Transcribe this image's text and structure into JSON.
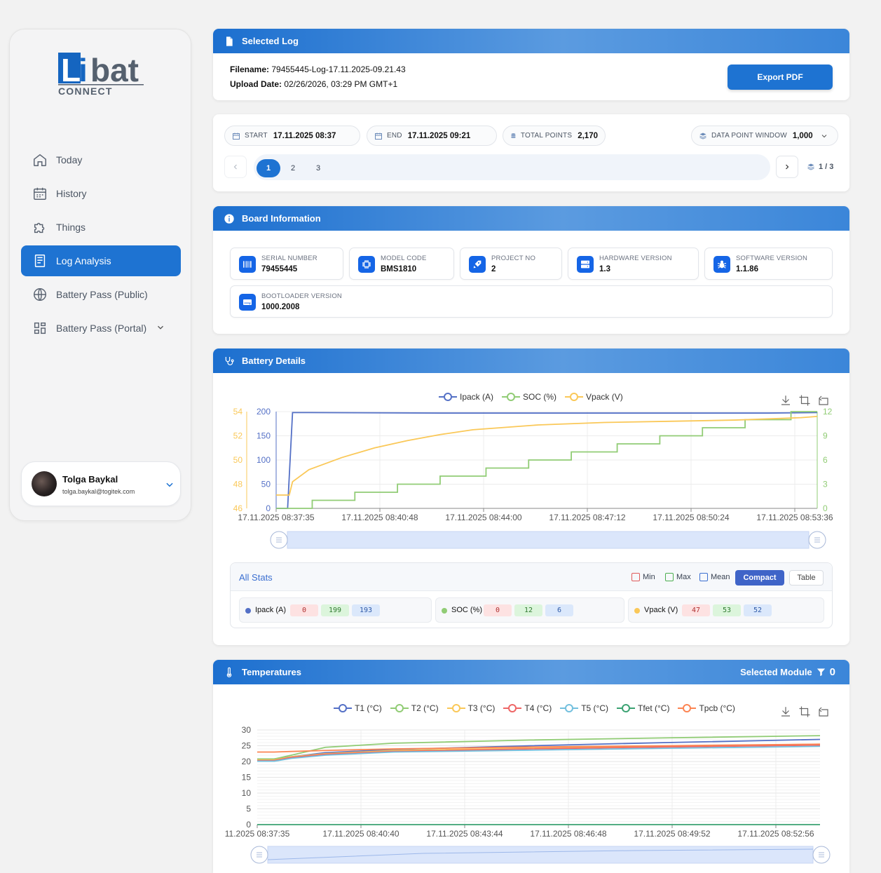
{
  "brand": {
    "logo_main": "Libat",
    "logo_sub": "CONNECT"
  },
  "nav": {
    "items": [
      {
        "label": "Today",
        "icon": "home-icon"
      },
      {
        "label": "History",
        "icon": "calendar-icon"
      },
      {
        "label": "Things",
        "icon": "puzzle-icon"
      },
      {
        "label": "Log Analysis",
        "icon": "document-icon",
        "active": true
      },
      {
        "label": "Battery Pass (Public)",
        "icon": "globe-icon"
      },
      {
        "label": "Battery Pass (Portal)",
        "icon": "grid-icon",
        "has_submenu": true
      }
    ]
  },
  "user": {
    "name": "Tolga Baykal",
    "email": "tolga.baykal@togitek.com"
  },
  "selected_log": {
    "title": "Selected Log",
    "filename_label": "Filename:",
    "filename": "79455445-Log-17.11.2025-09.21.43",
    "upload_label": "Upload Date:",
    "upload_date": "02/26/2026, 03:29 PM GMT+1",
    "export_label": "Export PDF"
  },
  "range": {
    "start_label": "START",
    "start": "17.11.2025 08:37",
    "end_label": "END",
    "end": "17.11.2025 09:21",
    "total_label": "TOTAL POINTS",
    "total": "2,170",
    "window_label": "DATA POINT WINDOW",
    "window": "1,000",
    "pages": [
      "1",
      "2",
      "3"
    ],
    "current_page": 1,
    "page_indicator": "1 / 3"
  },
  "board": {
    "title": "Board Information",
    "fields": [
      {
        "label": "SERIAL NUMBER",
        "value": "79455445",
        "icon": "barcode-icon"
      },
      {
        "label": "MODEL CODE",
        "value": "BMS1810",
        "icon": "chip-icon"
      },
      {
        "label": "PROJECT NO",
        "value": "2",
        "icon": "rocket-icon"
      },
      {
        "label": "HARDWARE VERSION",
        "value": "1.3",
        "icon": "server-icon"
      },
      {
        "label": "SOFTWARE VERSION",
        "value": "1.1.86",
        "icon": "bug-icon"
      },
      {
        "label": "BOOTLOADER VERSION",
        "value": "1000.2008",
        "icon": "drive-icon"
      }
    ]
  },
  "battery": {
    "title": "Battery Details",
    "stats_title": "All Stats",
    "toggles": {
      "min": "Min",
      "max": "Max",
      "mean": "Mean",
      "compact": "Compact",
      "table": "Table"
    },
    "stats": [
      {
        "name": "Ipack (A)",
        "color": "#5470c6",
        "min": "0",
        "max": "199",
        "mean": "193"
      },
      {
        "name": "SOC (%)",
        "color": "#91cc75",
        "min": "0",
        "max": "12",
        "mean": "6"
      },
      {
        "name": "Vpack (V)",
        "color": "#fac858",
        "min": "47",
        "max": "53",
        "mean": "52"
      }
    ]
  },
  "temps": {
    "title": "Temperatures",
    "module_label": "Selected Module",
    "module_value": "0"
  },
  "chart_data": [
    {
      "type": "line",
      "x_ticks": [
        "17.11.2025 08:37:35",
        "17.11.2025 08:40:48",
        "17.11.2025 08:44:00",
        "17.11.2025 08:47:12",
        "17.11.2025 08:50:24",
        "17.11.2025 08:53:36"
      ],
      "y_left_ticks": [
        "0",
        "50",
        "100",
        "150",
        "200"
      ],
      "y_left2_ticks": [
        "46",
        "48",
        "50",
        "52",
        "54"
      ],
      "y_right_ticks": [
        "0",
        "3",
        "6",
        "9",
        "12"
      ],
      "series": [
        {
          "name": "Ipack (A)",
          "color": "#5470c6",
          "axis": "left",
          "ylim": [
            0,
            200
          ],
          "x": [
            0,
            0.25,
            0.35,
            0.5,
            1,
            5,
            10,
            15,
            16.5
          ],
          "y": [
            0,
            0,
            0,
            198,
            198,
            197,
            197,
            197,
            198
          ]
        },
        {
          "name": "SOC (%)",
          "color": "#91cc75",
          "axis": "right",
          "ylim": [
            0,
            12
          ],
          "x": [
            0,
            1.1,
            2.4,
            3.7,
            5,
            6.4,
            7.7,
            9,
            10.4,
            11.7,
            13,
            14.3,
            15.7,
            16.5
          ],
          "y": [
            0,
            1,
            2,
            3,
            4,
            5,
            6,
            7,
            8,
            9,
            10,
            11,
            12,
            12
          ]
        },
        {
          "name": "Vpack (V)",
          "color": "#fac858",
          "axis": "left2",
          "ylim": [
            46,
            54
          ],
          "x": [
            0,
            0.4,
            0.5,
            1,
            2,
            3,
            4,
            5,
            6,
            8,
            10,
            12,
            14,
            16,
            16.5
          ],
          "y": [
            47.1,
            47.1,
            48.2,
            49.2,
            50.2,
            51,
            51.6,
            52.1,
            52.5,
            52.9,
            53.1,
            53.2,
            53.3,
            53.5,
            53.6
          ]
        }
      ]
    },
    {
      "type": "line",
      "x_ticks": [
        "11.2025 08:37:35",
        "17.11.2025 08:40:40",
        "17.11.2025 08:43:44",
        "17.11.2025 08:46:48",
        "17.11.2025 08:49:52",
        "17.11.2025 08:52:56"
      ],
      "y_ticks": [
        "0",
        "5",
        "10",
        "15",
        "20",
        "25",
        "30"
      ],
      "ylim": [
        0,
        30
      ],
      "series": [
        {
          "name": "T1 (°C)",
          "color": "#5470c6",
          "x": [
            0,
            0.5,
            1,
            2,
            4,
            8,
            12,
            16.5
          ],
          "y": [
            20.8,
            20.8,
            21.5,
            22.8,
            23.8,
            25,
            26,
            27
          ]
        },
        {
          "name": "T2 (°C)",
          "color": "#91cc75",
          "x": [
            0,
            0.5,
            1,
            2,
            4,
            8,
            12,
            16.5
          ],
          "y": [
            20.8,
            20.8,
            22,
            24.5,
            25.8,
            26.8,
            27.5,
            28.2
          ]
        },
        {
          "name": "T3 (°C)",
          "color": "#fac858",
          "x": [
            0,
            0.5,
            1,
            2,
            4,
            8,
            12,
            16.5
          ],
          "y": [
            20.5,
            20.5,
            21.5,
            22.5,
            23.5,
            24.2,
            24.8,
            25.5
          ]
        },
        {
          "name": "T4 (°C)",
          "color": "#ee6666",
          "x": [
            0,
            0.5,
            1,
            2,
            4,
            8,
            12,
            16.5
          ],
          "y": [
            20.3,
            20.3,
            21.3,
            22.3,
            23.2,
            24,
            24.6,
            25.2
          ]
        },
        {
          "name": "T5 (°C)",
          "color": "#73c0de",
          "x": [
            0,
            0.5,
            1,
            2,
            4,
            8,
            12,
            16.5
          ],
          "y": [
            20.1,
            20.1,
            21,
            22,
            23,
            23.6,
            24.2,
            24.8
          ]
        },
        {
          "name": "Tfet (°C)",
          "color": "#3ba272",
          "x": [
            0,
            16.5
          ],
          "y": [
            0,
            0
          ]
        },
        {
          "name": "Tpcb (°C)",
          "color": "#fc8452",
          "x": [
            0,
            0.5,
            1,
            2,
            4,
            8,
            12,
            16.5
          ],
          "y": [
            23,
            23,
            23.2,
            23.5,
            24,
            24.6,
            25,
            25.5
          ]
        }
      ]
    }
  ]
}
